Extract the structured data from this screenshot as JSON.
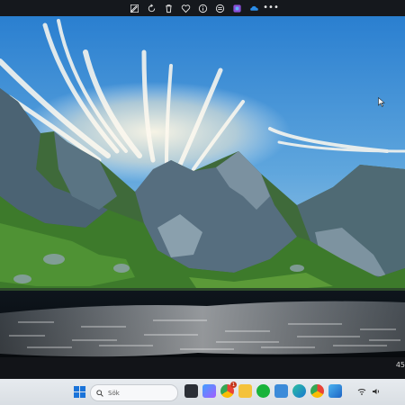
{
  "toolbar": {
    "icons": [
      "edit-icon",
      "rotate-icon",
      "delete-icon",
      "favorite-icon",
      "info-icon",
      "print-icon",
      "designer-icon",
      "onedrive-icon",
      "more-icon"
    ],
    "more_label": "•••"
  },
  "clock": {
    "time": "45"
  },
  "taskbar": {
    "search_label": "Sök",
    "icons": [
      "task-view",
      "copilot",
      "chrome",
      "file-explorer",
      "xbox",
      "notepad",
      "edge",
      "chrome-profile",
      "photos"
    ],
    "badge_count": "1"
  },
  "colors": {
    "sky_top": "#2f86d2",
    "sky_bottom": "#8fc2e3",
    "grass": "#4a8a2b",
    "rock": "#4e6778",
    "lake": "#141b22",
    "taskbar": "#e3e7eb"
  }
}
